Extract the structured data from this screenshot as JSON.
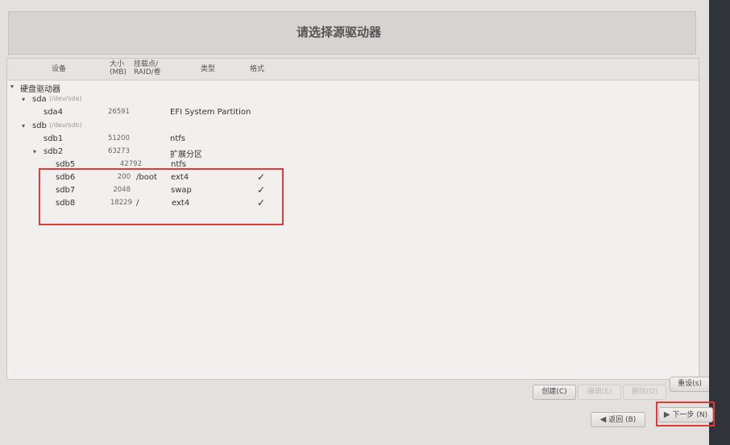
{
  "title": "请选择源驱动器",
  "columns": {
    "device": "设备",
    "size_line1": "大小",
    "size_line2": "(MB)",
    "mount_line1": "挂载点/",
    "mount_line2": "RAID/卷",
    "type": "类型",
    "format": "格式"
  },
  "tree": {
    "root_label": "硬盘驱动器",
    "sda": {
      "name": "sda",
      "path": "(/dev/sda)"
    },
    "sda4": {
      "name": "sda4",
      "size": "26591",
      "type": "EFI System Partition"
    },
    "sdb": {
      "name": "sdb",
      "path": "(/dev/sdb)"
    },
    "sdb1": {
      "name": "sdb1",
      "size": "51200",
      "type": "ntfs"
    },
    "sdb2": {
      "name": "sdb2",
      "size": "63273",
      "type": "扩展分区"
    },
    "sdb5": {
      "name": "sdb5",
      "size": "42792",
      "type": "ntfs"
    },
    "sdb6": {
      "name": "sdb6",
      "size": "200",
      "mount": "/boot",
      "type": "ext4",
      "format": "✓"
    },
    "sdb7": {
      "name": "sdb7",
      "size": "2048",
      "type": "swap",
      "format": "✓"
    },
    "sdb8": {
      "name": "sdb8",
      "size": "18229",
      "mount": "/",
      "type": "ext4",
      "format": "✓"
    }
  },
  "icons": {
    "expand": "▾",
    "back_arrow": "◀",
    "next_arrow": "▶"
  },
  "buttons": {
    "create": "创建(C)",
    "edit": "编辑(E)",
    "delete": "删除(D)",
    "reset": "重设(s)",
    "back": "返回 (B)",
    "next": "下一步 (N)"
  },
  "colors": {
    "highlight_box": "#e03a3a"
  }
}
